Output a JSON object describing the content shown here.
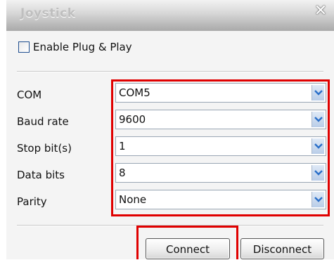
{
  "window": {
    "title": "Joystick",
    "close_symbol": "✕"
  },
  "options": {
    "plug_play_label": "Enable Plug & Play",
    "plug_play_checked": false
  },
  "fields": [
    {
      "label": "COM",
      "value": "COM5"
    },
    {
      "label": "Baud rate",
      "value": "9600"
    },
    {
      "label": "Stop bit(s)",
      "value": "1"
    },
    {
      "label": "Data bits",
      "value": "8"
    },
    {
      "label": "Parity",
      "value": "None"
    }
  ],
  "buttons": {
    "connect_label": "Connect",
    "disconnect_label": "Disconnect"
  },
  "icons": {
    "close": "close-icon",
    "dropdown": "chevron-down-icon"
  },
  "colors": {
    "highlight": "#e00000",
    "chevron": "#2a6fc9"
  }
}
